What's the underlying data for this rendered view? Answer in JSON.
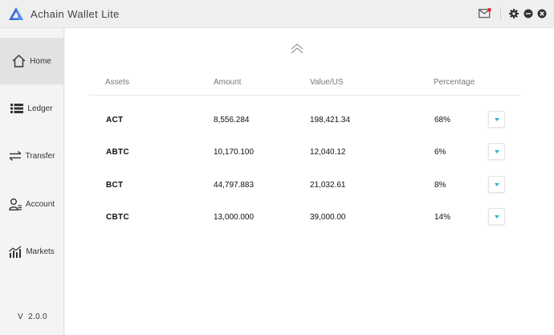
{
  "app": {
    "title": "Achain Wallet Lite",
    "accent_color": "#3b6fd8",
    "notification_color": "#e0262f"
  },
  "window_controls": [
    "settings-icon",
    "minimize-icon",
    "close-icon"
  ],
  "sidebar": {
    "items": [
      {
        "label": "Home",
        "icon": "home-icon",
        "active": true
      },
      {
        "label": "Ledger",
        "icon": "ledger-icon",
        "active": false
      },
      {
        "label": "Transfer",
        "icon": "transfer-icon",
        "active": false
      },
      {
        "label": "Account",
        "icon": "account-icon",
        "active": false
      },
      {
        "label": "Markets",
        "icon": "markets-icon",
        "active": false
      }
    ],
    "version": "V  2.0.0"
  },
  "table": {
    "headers": {
      "assets": "Assets",
      "amount": "Amount",
      "value": "Value/US",
      "percentage": "Percentage"
    },
    "rows": [
      {
        "asset": "ACT",
        "amount": "8,556.284",
        "value": "198,421.34",
        "percentage": "68%"
      },
      {
        "asset": "ABTC",
        "amount": "10,170.100",
        "value": "12,040.12",
        "percentage": "6%"
      },
      {
        "asset": "BCT",
        "amount": "44,797.883",
        "value": "21,032.61",
        "percentage": "8%"
      },
      {
        "asset": "CBTC",
        "amount": "13,000.000",
        "value": "39,000.00",
        "percentage": "14%"
      }
    ],
    "dropdown_color": "#2bb6c4"
  }
}
